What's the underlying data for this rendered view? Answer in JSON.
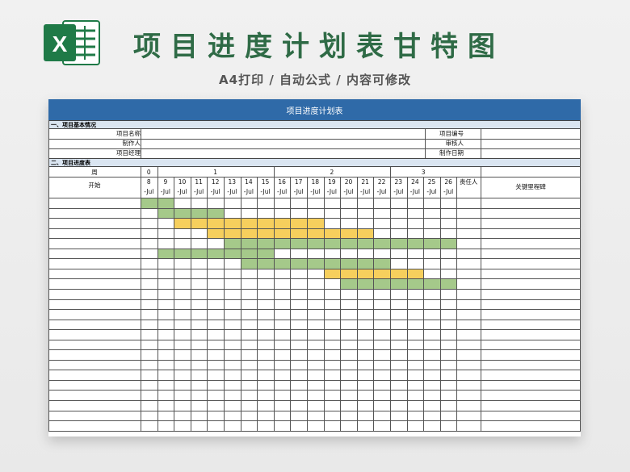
{
  "header": {
    "title": "项目进度计划表甘特图",
    "subtitle": "A4打印 / 自动公式 / 内容可修改",
    "logo_letter": "X"
  },
  "sheet": {
    "title": "项目进度计划表",
    "section1": "一、项目基本情况",
    "section2": "二、项目进度表",
    "info_left": [
      "项目名称",
      "制作人",
      "项目经理"
    ],
    "info_right": [
      "项目编号",
      "审核人",
      "制作日期"
    ],
    "week_label": "周",
    "weeks": [
      "0",
      "1",
      "2",
      "3"
    ],
    "start_label": "开始",
    "days": [
      "8",
      "9",
      "10",
      "11",
      "12",
      "13",
      "14",
      "15",
      "16",
      "17",
      "18",
      "19",
      "20",
      "21",
      "22",
      "23",
      "24",
      "25",
      "26"
    ],
    "day_suffix": "-Jul",
    "owner_label": "责任人",
    "milestone_label": "关键里程碑"
  },
  "gantt": [
    {
      "row": 0,
      "start": 0,
      "end": 1,
      "color": "green"
    },
    {
      "row": 1,
      "start": 1,
      "end": 4,
      "color": "green"
    },
    {
      "row": 2,
      "start": 2,
      "end": 10,
      "color": "yellow"
    },
    {
      "row": 3,
      "start": 4,
      "end": 13,
      "color": "yellow"
    },
    {
      "row": 4,
      "start": 5,
      "end": 18,
      "color": "green"
    },
    {
      "row": 5,
      "start": 1,
      "end": 7,
      "color": "green"
    },
    {
      "row": 6,
      "start": 6,
      "end": 14,
      "color": "green"
    },
    {
      "row": 7,
      "start": 11,
      "end": 16,
      "color": "yellow"
    },
    {
      "row": 8,
      "start": 12,
      "end": 18,
      "color": "green"
    }
  ],
  "colors": {
    "green": "#a5c98a",
    "yellow": "#f6cf5d",
    "header_blue": "#2f6aa8",
    "section_bg": "#dae5f1",
    "title_green": "#2f6b46"
  }
}
